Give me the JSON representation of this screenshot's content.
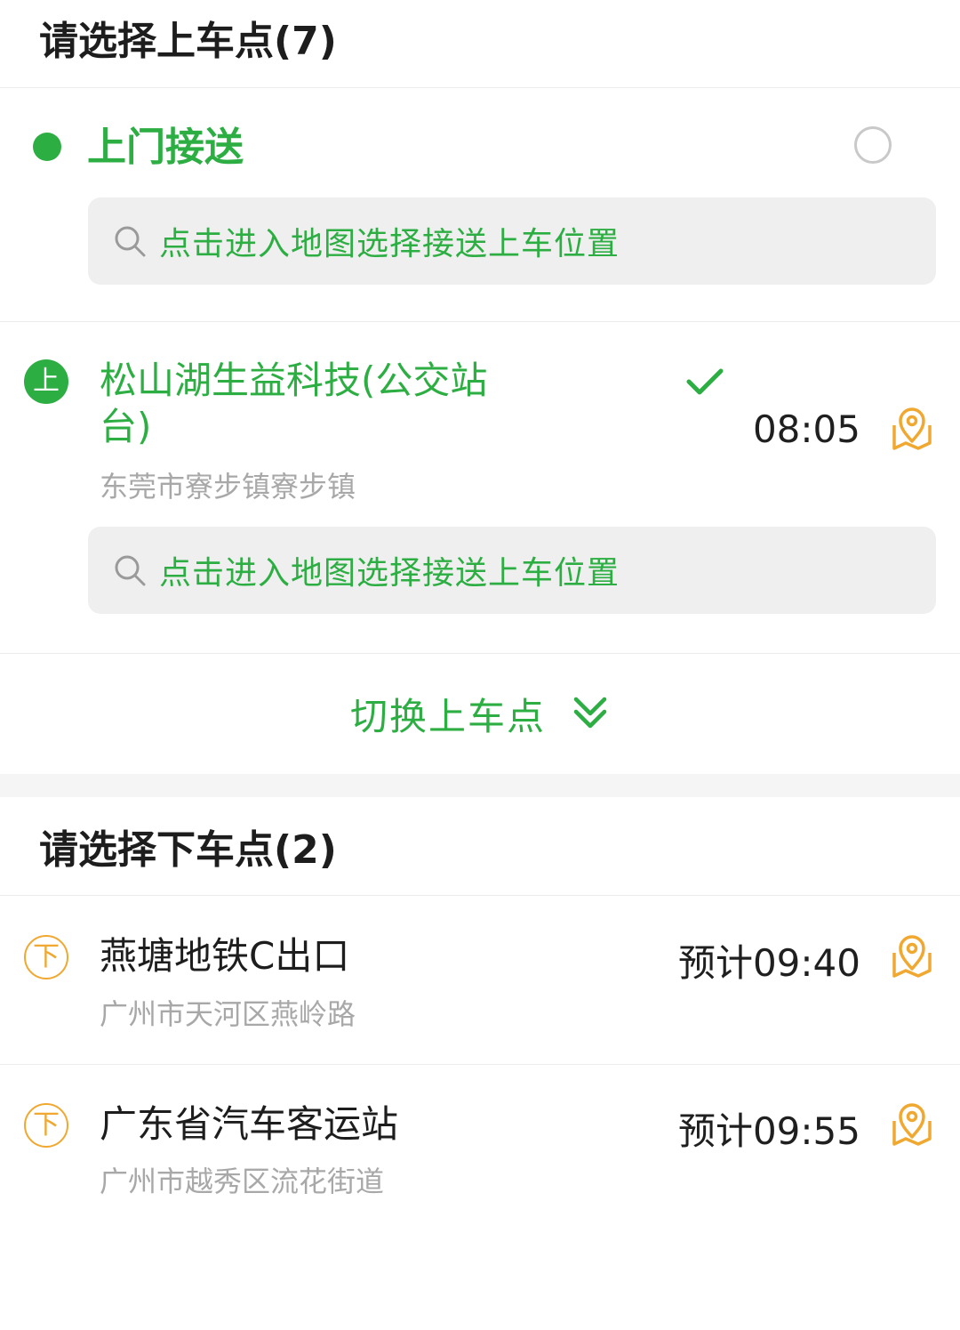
{
  "pickup": {
    "title": "请选择上车点(7)",
    "door": {
      "label": "上门接送",
      "search_text": "点击进入地图选择接送上车位置"
    },
    "station": {
      "badge": "上",
      "name": "松山湖生益科技(公交站台)",
      "address": "东莞市寮步镇寮步镇",
      "time": "08:05",
      "search_text": "点击进入地图选择接送上车位置"
    },
    "switch_label": "切换上车点"
  },
  "dropoff": {
    "title": "请选择下车点(2)",
    "stations": [
      {
        "badge": "下",
        "name": "燕塘地铁C出口",
        "address": "广州市天河区燕岭路",
        "time": "预计09:40"
      },
      {
        "badge": "下",
        "name": "广东省汽车客运站",
        "address": "广州市越秀区流花街道",
        "time": "预计09:55"
      }
    ]
  },
  "colors": {
    "accent_green": "#2dae43",
    "accent_orange": "#f0a830",
    "muted_text": "#a8a8a8"
  },
  "icons": [
    "search-icon",
    "check-icon",
    "map-pin-icon",
    "chevron-double-down-icon"
  ]
}
